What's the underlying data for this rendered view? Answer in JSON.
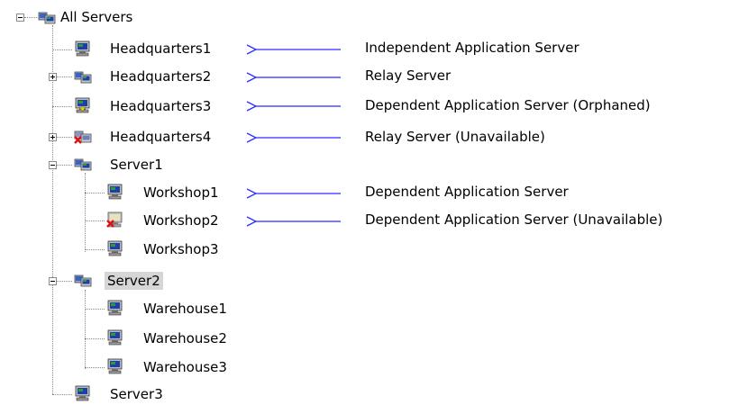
{
  "tree": {
    "root": {
      "label": "All Servers",
      "icon": "server-group-icon",
      "expanded": true
    },
    "nodes": [
      {
        "label": "Headquarters1",
        "icon": "computer-icon",
        "description": "Independent Application Server"
      },
      {
        "label": "Headquarters2",
        "icon": "relay-server-icon",
        "expanded": false,
        "description": "Relay Server"
      },
      {
        "label": "Headquarters3",
        "icon": "orphaned-computer-icon",
        "description": "Dependent Application Server (Orphaned)"
      },
      {
        "label": "Headquarters4",
        "icon": "unavailable-relay-server-icon",
        "expanded": false,
        "description": "Relay Server (Unavailable)"
      },
      {
        "label": "Server1",
        "icon": "relay-server-icon",
        "expanded": true,
        "children": [
          {
            "label": "Workshop1",
            "icon": "computer-icon",
            "description": "Dependent Application Server"
          },
          {
            "label": "Workshop2",
            "icon": "unavailable-computer-icon",
            "description": "Dependent Application Server (Unavailable)"
          },
          {
            "label": "Workshop3",
            "icon": "computer-icon"
          }
        ]
      },
      {
        "label": "Server2",
        "icon": "relay-server-icon",
        "expanded": true,
        "selected": true,
        "children": [
          {
            "label": "Warehouse1",
            "icon": "computer-icon"
          },
          {
            "label": "Warehouse2",
            "icon": "computer-icon"
          },
          {
            "label": "Warehouse3",
            "icon": "computer-icon"
          }
        ]
      },
      {
        "label": "Server3",
        "icon": "computer-icon"
      }
    ]
  },
  "colors": {
    "arrow": "#2b2bff",
    "selection": "#d6d6d6",
    "monitor_blue": "#1c3fa8",
    "monitor_green": "#2e9a3a",
    "error_red": "#e01010",
    "orphan_yellow": "#e8d000"
  }
}
